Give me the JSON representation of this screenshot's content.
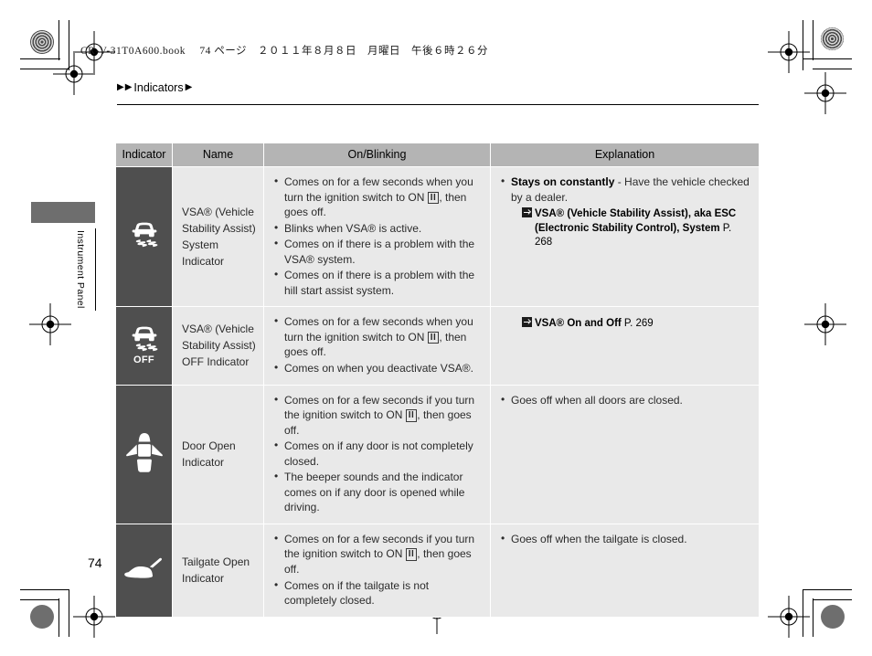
{
  "page": {
    "book_line": "CR-V-31T0A600.book  74 ページ ２０１１年８月８日　月曜日　午後６時２６分",
    "number": "74",
    "side_tab_label": "Instrument Panel"
  },
  "breadcrumb": {
    "leading_marker_1": "▶",
    "leading_marker_2": "▶",
    "label": "Indicators",
    "trailing_marker": "▶"
  },
  "table": {
    "headers": [
      "Indicator",
      "Name",
      "On/Blinking",
      "Explanation"
    ],
    "rows": [
      {
        "icon_name": "vsa-system-indicator-icon",
        "icon_off_label": "",
        "name": "VSA® (Vehicle Stability Assist) System Indicator",
        "on_blinking": [
          {
            "pre": "Comes on for a few seconds when you turn the ignition switch to ON ",
            "ign": "II",
            "post": ", then goes off."
          },
          {
            "pre": "Blinks when VSA® is active.",
            "ign": "",
            "post": ""
          },
          {
            "pre": "Comes on if there is a problem with the VSA® system.",
            "ign": "",
            "post": ""
          },
          {
            "pre": "Comes on if there is a problem with the hill start assist system.",
            "ign": "",
            "post": ""
          }
        ],
        "explanation": [
          {
            "bold": "Stays on constantly",
            "rest": " - Have the vehicle checked by a dealer."
          }
        ],
        "xref": {
          "line1": "VSA® (Vehicle Stability Assist), aka ESC",
          "line2": "(Electronic Stability Control), System",
          "page": "P. 268"
        }
      },
      {
        "icon_name": "vsa-off-indicator-icon",
        "icon_off_label": "OFF",
        "name": "VSA® (Vehicle Stability Assist) OFF Indicator",
        "on_blinking": [
          {
            "pre": "Comes on for a few seconds when you turn the ignition switch to ON ",
            "ign": "II",
            "post": ", then goes off."
          },
          {
            "pre": "Comes on when you deactivate VSA®.",
            "ign": "",
            "post": ""
          }
        ],
        "explanation": [],
        "xref": {
          "line1": "VSA® On and Off",
          "line2": "",
          "page": "P. 269"
        }
      },
      {
        "icon_name": "door-open-indicator-icon",
        "icon_off_label": "",
        "name": "Door Open Indicator",
        "on_blinking": [
          {
            "pre": "Comes on for a few seconds if you turn the ignition switch to ON ",
            "ign": "II",
            "post": ", then goes off."
          },
          {
            "pre": "Comes on if any door is not completely closed.",
            "ign": "",
            "post": ""
          },
          {
            "pre": "The beeper sounds and the indicator comes on if any door is opened while driving.",
            "ign": "",
            "post": ""
          }
        ],
        "explanation": [
          {
            "bold": "",
            "rest": "Goes off when all doors are closed."
          }
        ],
        "xref": null
      },
      {
        "icon_name": "tailgate-open-indicator-icon",
        "icon_off_label": "",
        "name": "Tailgate Open Indicator",
        "on_blinking": [
          {
            "pre": "Comes on for a few seconds if you turn the ignition switch to ON ",
            "ign": "II",
            "post": ", then goes off."
          },
          {
            "pre": "Comes on if the tailgate is not completely closed.",
            "ign": "",
            "post": ""
          }
        ],
        "explanation": [
          {
            "bold": "",
            "rest": "Goes off when the tailgate is closed."
          }
        ],
        "xref": null
      }
    ]
  },
  "colors": {
    "header_bg": "#b4b4b4",
    "cell_bg": "#e9e9e9",
    "icon_cell_bg": "#4f4f4f",
    "tab_gray": "#6e6e6e"
  }
}
